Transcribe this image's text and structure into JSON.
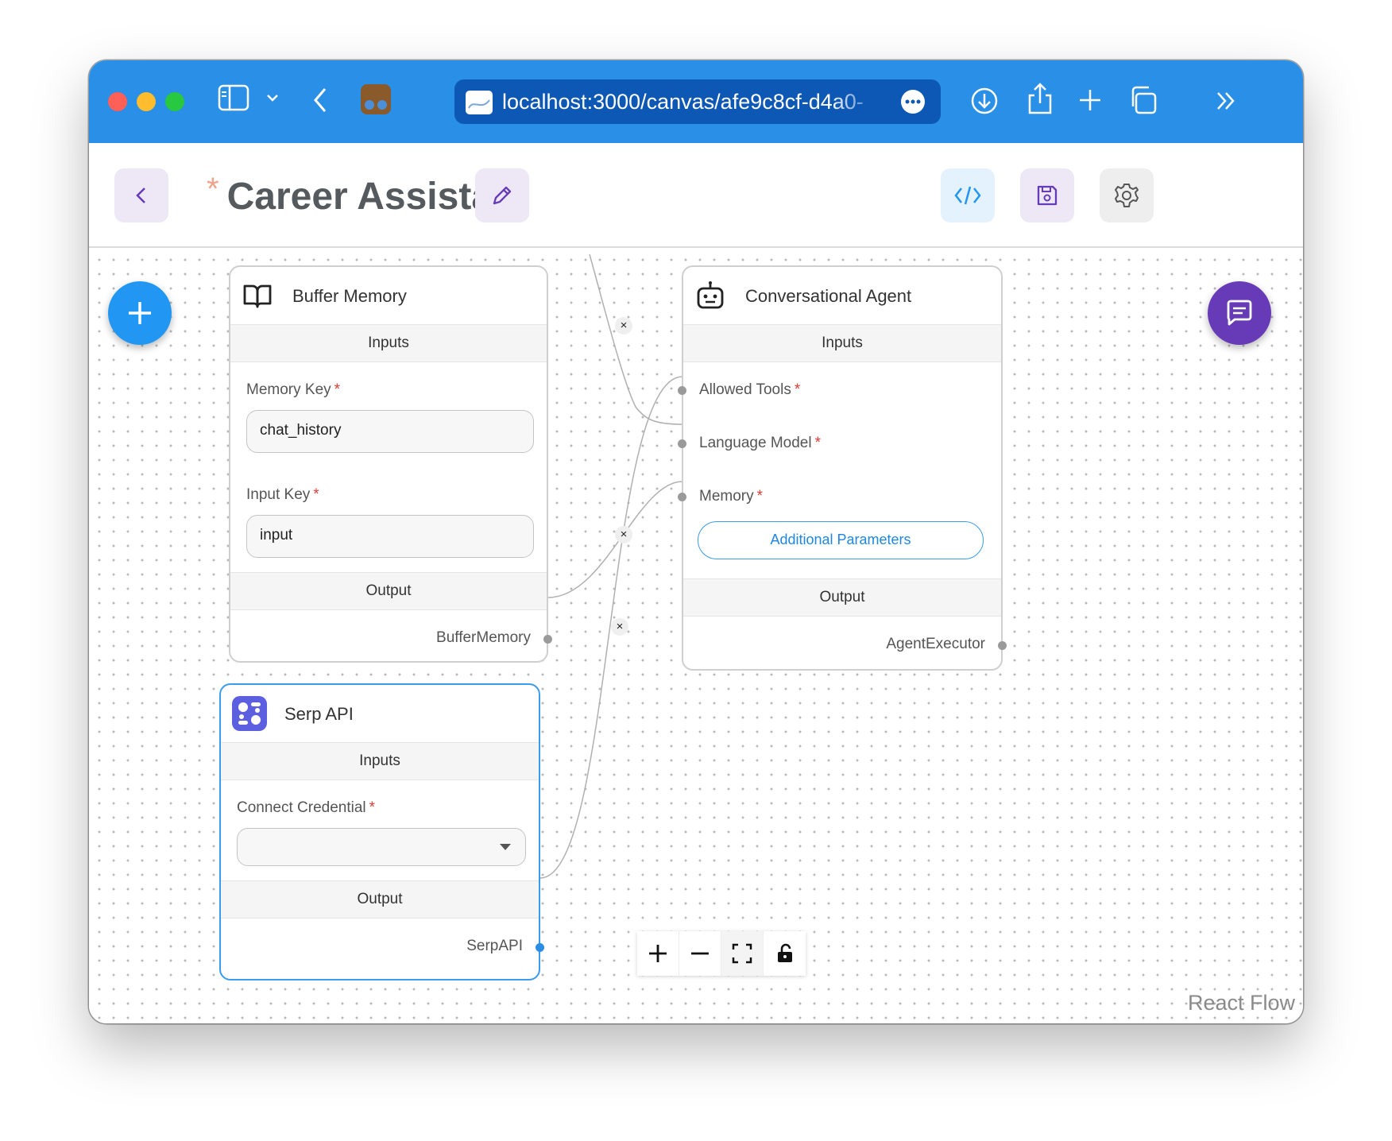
{
  "browser": {
    "url": "localhost:3000/canvas/afe9c8cf-d4a0-"
  },
  "header": {
    "title": "Career Assistant",
    "unsaved_marker": "*"
  },
  "nodes": {
    "buffer_memory": {
      "name": "Buffer Memory",
      "inputs_label": "Inputs",
      "memory_key_label": "Memory Key",
      "memory_key_value": "chat_history",
      "input_key_label": "Input Key",
      "input_key_value": "input",
      "output_label": "Output",
      "output_name": "BufferMemory",
      "required_mark": "*"
    },
    "serp_api": {
      "name": "Serp API",
      "inputs_label": "Inputs",
      "credential_label": "Connect Credential",
      "credential_value": "",
      "output_label": "Output",
      "output_name": "SerpAPI",
      "required_mark": "*"
    },
    "conversational_agent": {
      "name": "Conversational Agent",
      "inputs_label": "Inputs",
      "allowed_tools_label": "Allowed Tools",
      "language_model_label": "Language Model",
      "memory_label": "Memory",
      "additional_params_label": "Additional Parameters",
      "output_label": "Output",
      "output_name": "AgentExecutor",
      "required_mark": "*"
    }
  },
  "edge_delete_symbol": "×",
  "watermark": "React Flow",
  "colors": {
    "titlebar": "#2a8fe6",
    "accent_blue": "#2196f3",
    "accent_purple": "#673ab7",
    "required": "#e53935"
  },
  "icons": {
    "back": "chevron-left-icon",
    "edit": "pencil-icon",
    "code": "code-icon",
    "save": "save-icon",
    "settings": "gear-icon",
    "add": "plus-icon",
    "chat": "chat-icon"
  }
}
